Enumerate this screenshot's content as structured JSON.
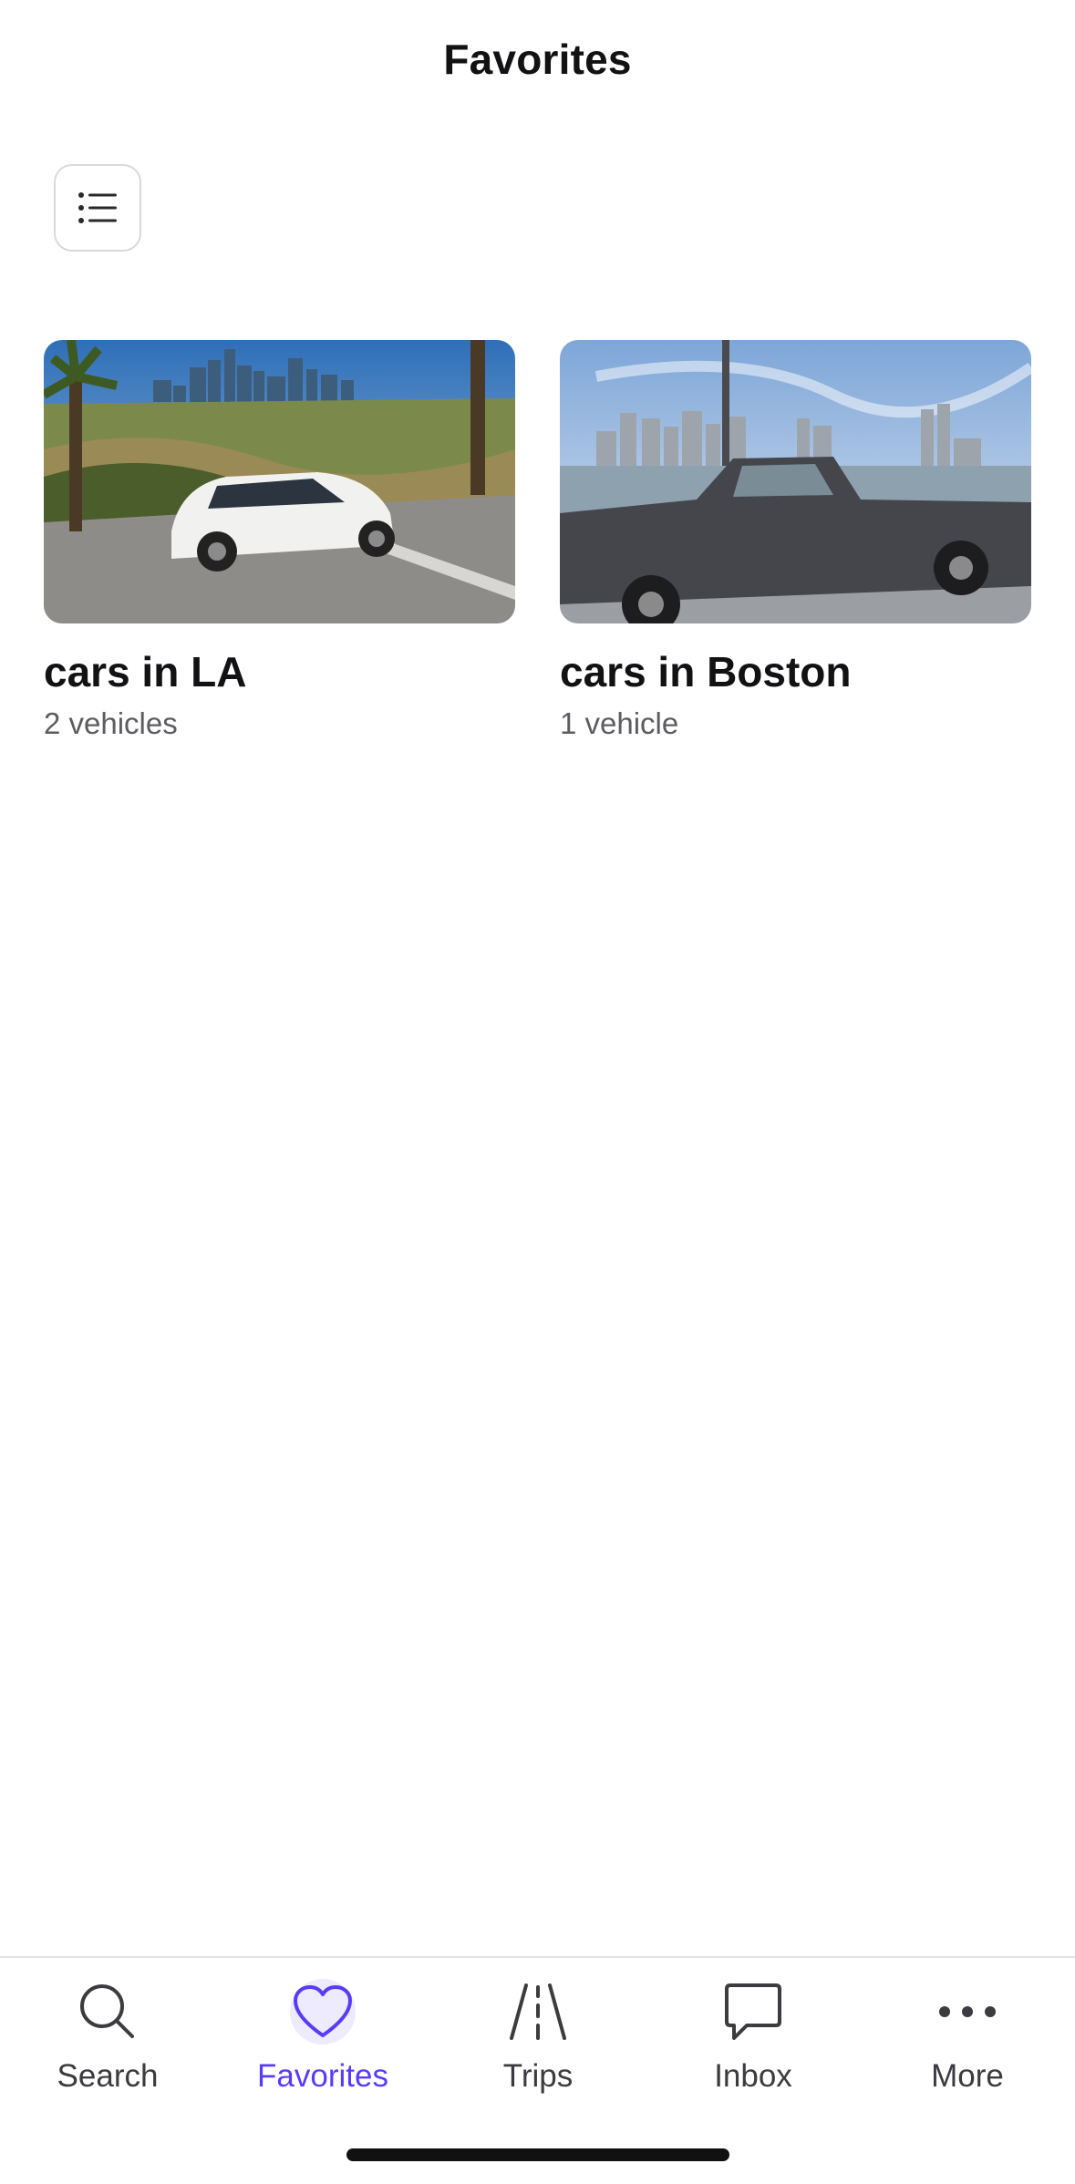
{
  "header": {
    "title": "Favorites"
  },
  "toolbar": {
    "view_toggle_icon": "list-view-icon"
  },
  "collections": [
    {
      "title": "cars in LA",
      "subtitle": "2 vehicles",
      "image": "white compact SUV parked on hillside with Los Angeles skyline and palm trees"
    },
    {
      "title": "cars in Boston",
      "subtitle": "1 vehicle",
      "image": "dark gray pickup truck by the harbor with Boston skyline"
    }
  ],
  "tab_bar": {
    "active": "Favorites",
    "active_color": "#593cfb",
    "items": [
      {
        "label": "Search",
        "icon": "search-icon"
      },
      {
        "label": "Favorites",
        "icon": "heart-icon"
      },
      {
        "label": "Trips",
        "icon": "road-icon"
      },
      {
        "label": "Inbox",
        "icon": "chat-bubble-icon"
      },
      {
        "label": "More",
        "icon": "more-dots-icon"
      }
    ]
  }
}
